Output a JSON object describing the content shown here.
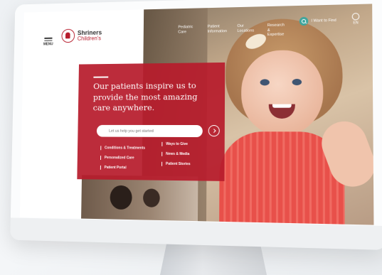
{
  "logo": {
    "name_line1": "Shriners",
    "name_line2": "Children's"
  },
  "menu": {
    "label": "MENU"
  },
  "nav": {
    "items": [
      "Pediatric Care",
      "Patient Information",
      "Our Locations",
      "Research & Expertise"
    ],
    "search_label": "I Want to Find",
    "language": "EN"
  },
  "hero": {
    "title": "Our patients inspire us to provide the most amazing care anywhere.",
    "search_placeholder": "Let us help you get started",
    "links_left": [
      "Conditions & Treatments",
      "Personalized Care",
      "Patient Portal"
    ],
    "links_right": [
      "Ways to Give",
      "News & Media",
      "Patient Stories"
    ]
  },
  "colors": {
    "brand_red": "#b71c2c",
    "search_accent": "#3fa59d"
  }
}
